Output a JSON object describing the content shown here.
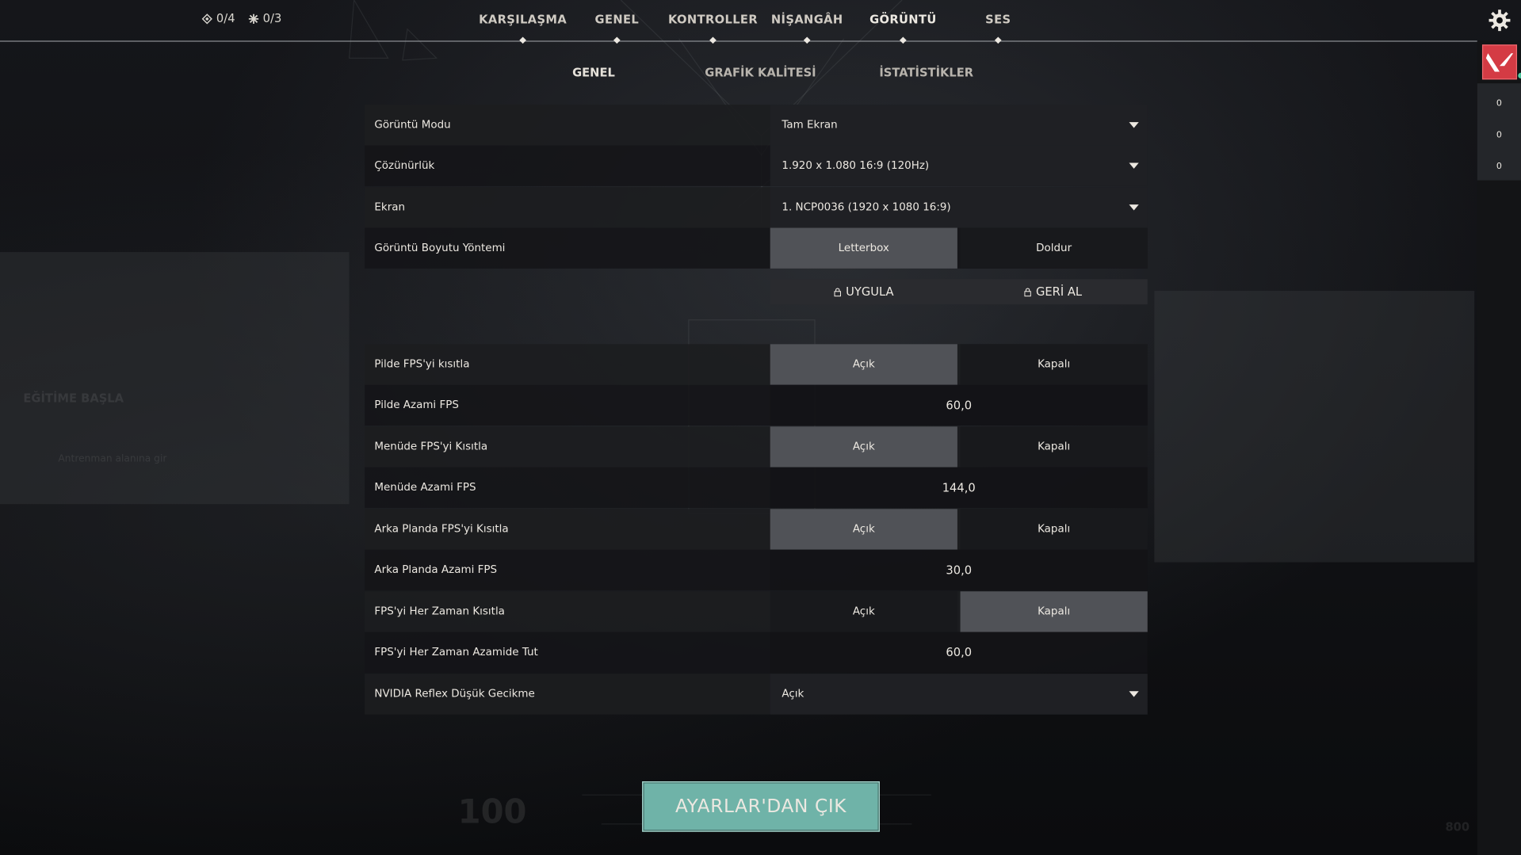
{
  "counters": [
    {
      "icon": "diamond-icon",
      "value": "0/4"
    },
    {
      "icon": "star-icon",
      "value": "0/3"
    }
  ],
  "nav": {
    "tabs": [
      {
        "label": "KARŞILAŞMA",
        "active": false
      },
      {
        "label": "GENEL",
        "active": false
      },
      {
        "label": "KONTROLLER",
        "active": false
      },
      {
        "label": "NİŞANGÂH",
        "active": false
      },
      {
        "label": "GÖRÜNTÜ",
        "active": true
      },
      {
        "label": "SES",
        "active": false
      }
    ]
  },
  "subtabs": [
    {
      "label": "GENEL",
      "active": true
    },
    {
      "label": "GRAFİK KALİTESİ",
      "active": false
    },
    {
      "label": "İSTATİSTİKLER",
      "active": false
    }
  ],
  "settings": {
    "display_mode": {
      "label": "Görüntü Modu",
      "value": "Tam Ekran"
    },
    "resolution": {
      "label": "Çözünürlük",
      "value": "1.920 x 1.080 16:9 (120Hz)"
    },
    "monitor": {
      "label": "Ekran",
      "value": "1. NCP0036 (1920 x  1080 16:9)"
    },
    "aspect_method": {
      "label": "Görüntü Boyutu Yöntemi",
      "options": [
        "Letterbox",
        "Doldur"
      ],
      "selected": "Letterbox"
    },
    "apply": {
      "apply_label": "UYGULA",
      "revert_label": "GERİ AL"
    },
    "limit_fps_battery": {
      "label": "Pilde FPS'yi kısıtla",
      "options": [
        "Açık",
        "Kapalı"
      ],
      "selected": "Açık"
    },
    "max_fps_battery": {
      "label": "Pilde Azami FPS",
      "value": "60,0"
    },
    "limit_fps_menu": {
      "label": "Menüde FPS'yi Kısıtla",
      "options": [
        "Açık",
        "Kapalı"
      ],
      "selected": "Açık"
    },
    "max_fps_menu": {
      "label": "Menüde Azami FPS",
      "value": "144,0"
    },
    "limit_fps_background": {
      "label": "Arka Planda FPS'yi Kısıtla",
      "options": [
        "Açık",
        "Kapalı"
      ],
      "selected": "Açık"
    },
    "max_fps_background": {
      "label": "Arka Planda Azami FPS",
      "value": "30,0"
    },
    "limit_fps_always": {
      "label": "FPS'yi Her Zaman Kısıtla",
      "options": [
        "Açık",
        "Kapalı"
      ],
      "selected": "Kapalı"
    },
    "max_fps_always": {
      "label": "FPS'yi Her Zaman Azamide Tut",
      "value": "60,0"
    },
    "nvidia_reflex": {
      "label": "NVIDIA Reflex Düşük Gecikme",
      "value": "Açık"
    }
  },
  "exit_button": "AYARLAR'DAN ÇIK",
  "sidebar": {
    "counts": [
      "0",
      "0",
      "0"
    ]
  },
  "background_text": {
    "training": "EĞİTİME BAŞLA",
    "hint": "Antrenman alanına gir",
    "health": "100",
    "credits": "800"
  },
  "colors": {
    "accent": "#6fb3a8",
    "avatar": "#d43b44",
    "selected_option": "#505257"
  }
}
